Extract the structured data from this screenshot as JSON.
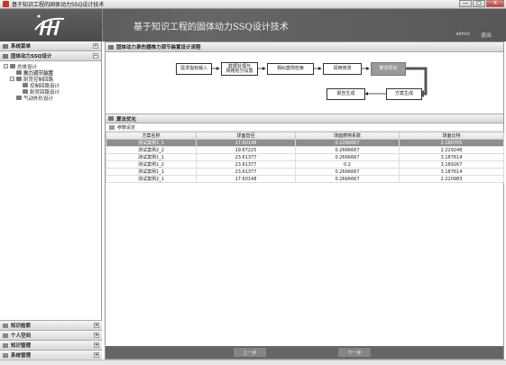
{
  "window": {
    "title": "基于知识工程的固体动力SSQ设计技术",
    "min": "—",
    "max": "□",
    "close": "X"
  },
  "banner": {
    "title": "基于知识工程的固体动力SSQ设计技术",
    "user": "admin",
    "logout": "退出"
  },
  "sidebar": {
    "header": "系统菜单",
    "section": "固体动力SSQ设计",
    "tree": [
      {
        "label": "总体设计",
        "level": 0
      },
      {
        "label": "推力调节装置",
        "level": 1,
        "selected": true
      },
      {
        "label": "耐背控制回路",
        "level": 1
      },
      {
        "label": "控制回路设计",
        "level": 2
      },
      {
        "label": "耐背回路设计",
        "level": 2
      },
      {
        "label": "气动外形设计",
        "level": 1
      }
    ],
    "accordion": [
      "知识检索",
      "个人空间",
      "知识管理",
      "系统管理"
    ]
  },
  "main": {
    "flow_title": "固体动力承伤器推力调节装置设计流程",
    "flow_nodes": [
      "需求指标输入",
      "数据处理与\n网格划分设置",
      "相似案例检索",
      "调用修改",
      "算法优化",
      "方案生成",
      "报告生成"
    ],
    "opt_title": "算法优化",
    "param_label": "参数设定",
    "table": {
      "headers": [
        "方案名称",
        "球面直径",
        "球面摩擦系数",
        "球面比特"
      ],
      "rows": [
        [
          "测试案例2_1",
          "17.60148",
          "0.2266667",
          "2.180705"
        ],
        [
          "测试案例2_2",
          "19.67225",
          "0.2666667",
          "2.229248"
        ],
        [
          "测试案例1_1",
          "23.61377",
          "0.2666667",
          "3.187614"
        ],
        [
          "测试案例1_2",
          "23.61377",
          "0.2",
          "3.189267"
        ],
        [
          "测试案例1_1",
          "23.61377",
          "0.2666667",
          "3.187614"
        ],
        [
          "测试案例2_1",
          "17.60148",
          "0.2666667",
          "2.220983"
        ]
      ],
      "selected_row": 0
    },
    "prev": "上一步",
    "next": "下一步"
  }
}
